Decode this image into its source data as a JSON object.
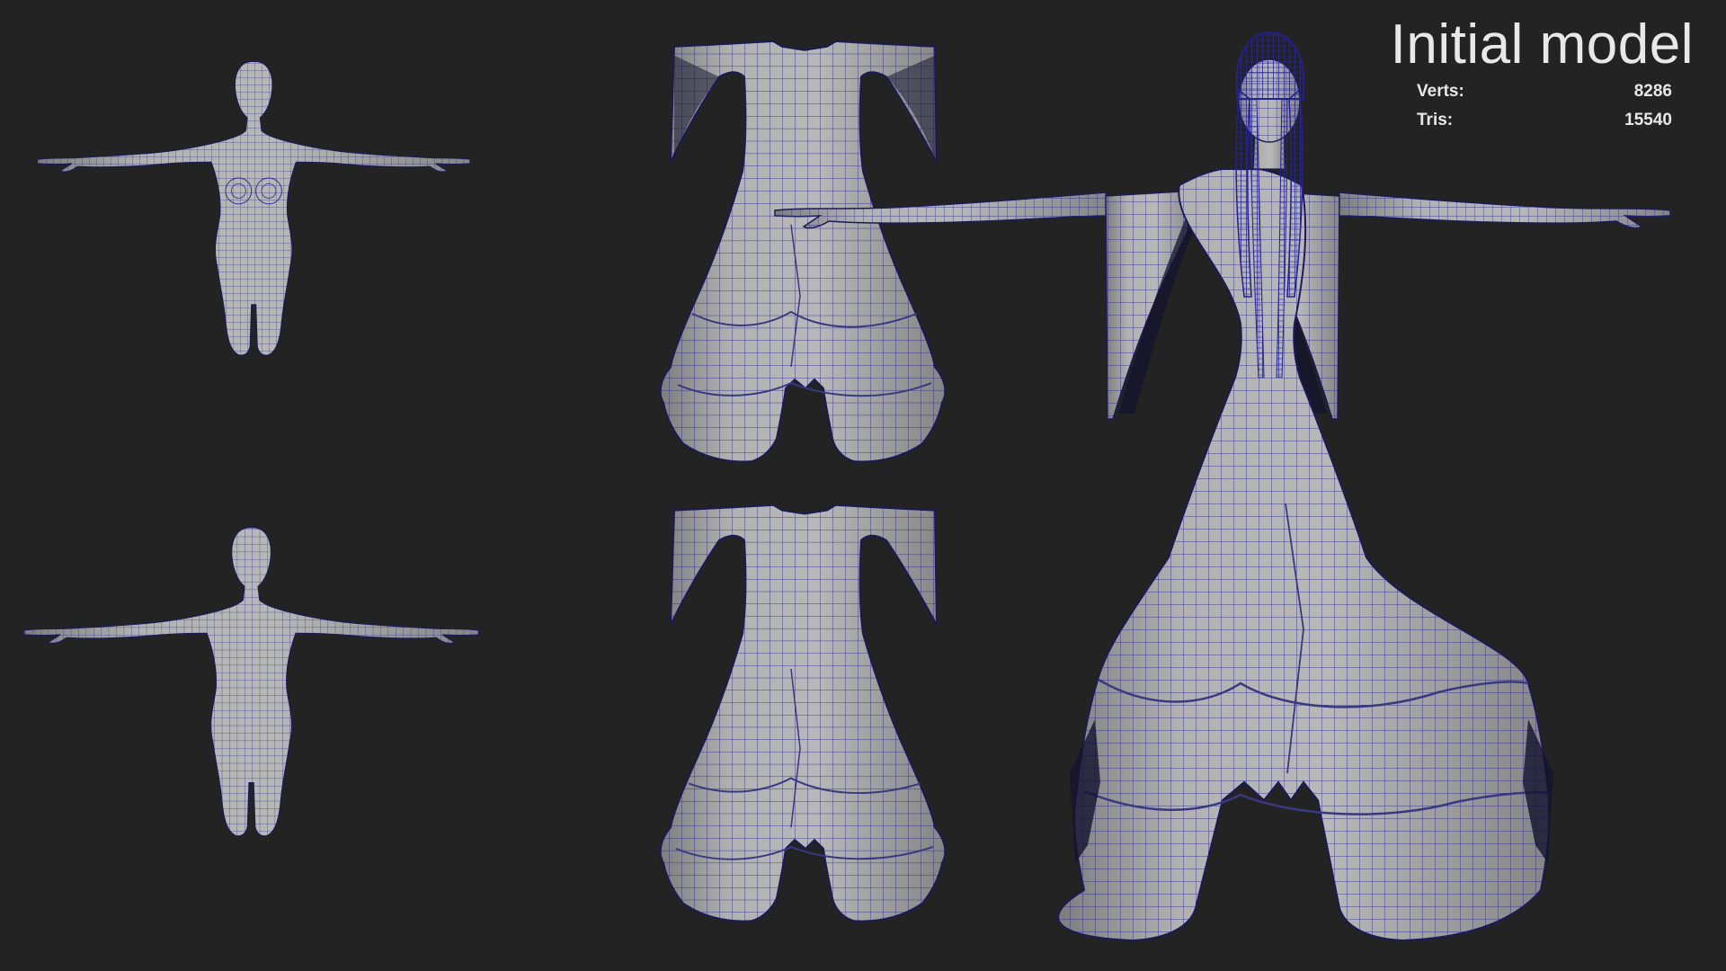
{
  "overlay": {
    "title": "Initial model",
    "stats": [
      {
        "label": "Verts:",
        "value": "8286"
      },
      {
        "label": "Tris:",
        "value": "15540"
      }
    ]
  },
  "colors": {
    "background": "#232323",
    "mesh_fill": "#a6a6a6",
    "wireframe": "#2d2a8c",
    "text": "#e8e8e8"
  },
  "views": [
    {
      "name": "body-front-view"
    },
    {
      "name": "body-back-view"
    },
    {
      "name": "dress-front-view"
    },
    {
      "name": "dress-back-view"
    },
    {
      "name": "full-character-view"
    }
  ]
}
